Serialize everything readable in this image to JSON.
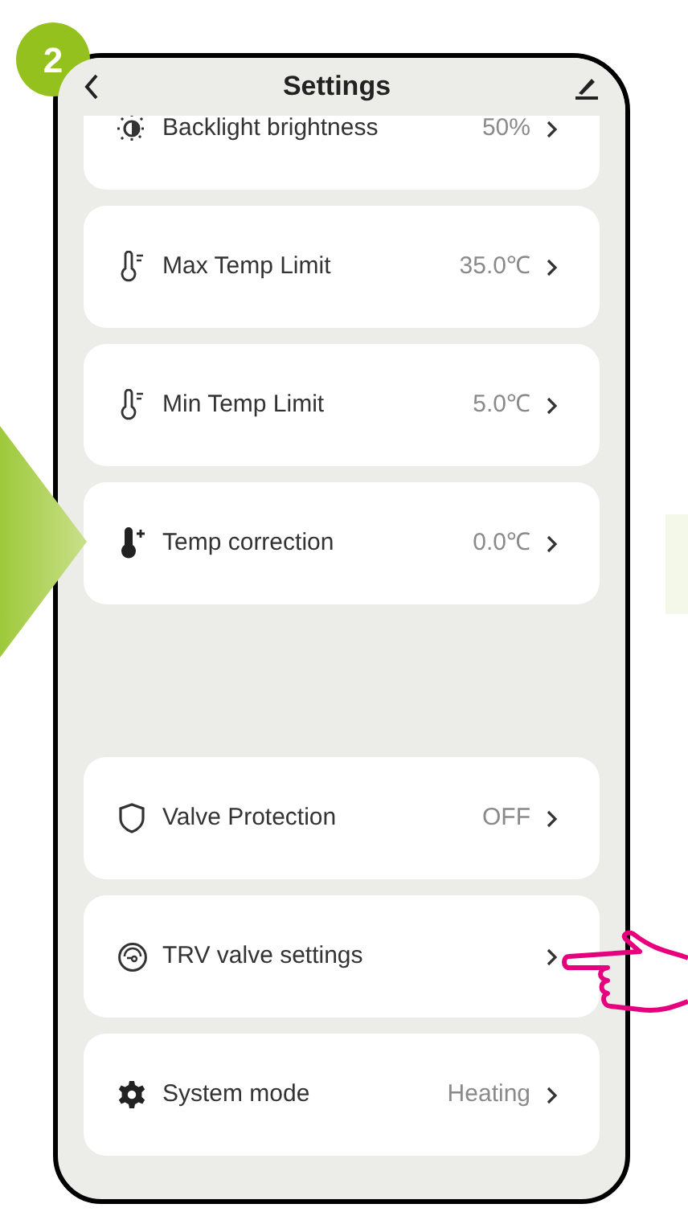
{
  "step_badge": "2",
  "header": {
    "title": "Settings"
  },
  "groups": [
    [
      {
        "label": "Backlight brightness",
        "value": "50%"
      },
      {
        "label": "Max Temp Limit",
        "value": "35.0℃"
      },
      {
        "label": "Min Temp Limit",
        "value": "5.0℃"
      },
      {
        "label": "Temp correction",
        "value": "0.0℃"
      }
    ],
    [
      {
        "label": "Valve Protection",
        "value": "OFF"
      },
      {
        "label": "TRV valve settings"
      },
      {
        "label": "System mode",
        "value": "Heating"
      }
    ]
  ]
}
